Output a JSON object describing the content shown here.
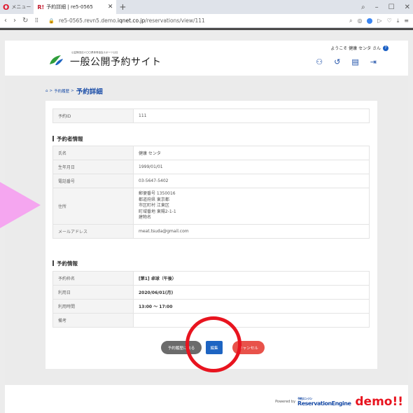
{
  "browser": {
    "menu_label": "メニュー",
    "tab_favicon": "R!",
    "tab_title": "予約詳細 | re5-0565",
    "url_prefix": "re5-0565.revn5.demo.",
    "url_domain": "iqnet.co.jp",
    "url_path": "/reservations/view/111"
  },
  "header": {
    "logo_subtitle": "公益財団法人〇〇県体育協会スポーツ公社",
    "logo_text": "一般公開予約サイト",
    "welcome": "ようこそ 健康 センタ さん"
  },
  "breadcrumb": {
    "parent": "予約履歴",
    "sep": ">",
    "current": "予約詳細"
  },
  "reservation_id": {
    "label": "予約ID",
    "value": "111"
  },
  "booker_section": {
    "title": "予約者情報",
    "rows": [
      {
        "label": "氏名",
        "value": "健康 センタ"
      },
      {
        "label": "生年月日",
        "value": "1999/01/01"
      },
      {
        "label": "電話番号",
        "value": "03-5647-5402"
      },
      {
        "label": "住所",
        "lines": [
          "郵便番号 1350016",
          "都道府県 東京都",
          "市区町村 江東区",
          "町域番地 東陽2-1-1",
          "建物名"
        ]
      },
      {
        "label": "メールアドレス",
        "value": "meat.tsuda@gmail.com"
      }
    ]
  },
  "booking_section": {
    "title": "予約情報",
    "rows": [
      {
        "label": "予約枠名",
        "value": "[第1] 卓球（午後）"
      },
      {
        "label": "利用日",
        "value": "2020/06/01(月)"
      },
      {
        "label": "利用時間",
        "value": "13:00 ～ 17:00"
      },
      {
        "label": "備考",
        "value": ""
      }
    ]
  },
  "buttons": {
    "back": "予約履歴に戻る",
    "edit": "編集",
    "cancel": "キャンセル"
  },
  "footer": {
    "powered_by": "Powered by",
    "logo_small": "予約エンジン",
    "logo_text": "ReservationEngine",
    "demo": "demo!!"
  },
  "colors": {
    "accent": "#1d4fa8",
    "annotation": "#e8141f",
    "pink": "#f5a6f0"
  }
}
